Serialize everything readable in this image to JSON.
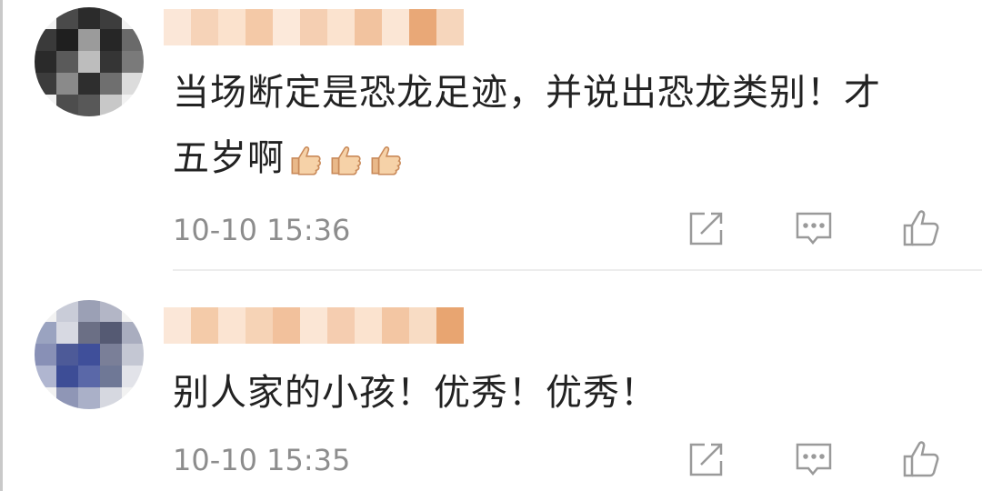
{
  "comments": [
    {
      "text": "当场断定是恐龙足迹，并说出恐龙类别！才五岁啊",
      "emoji": [
        "thumbs-up-icon",
        "thumbs-up-icon",
        "thumbs-up-icon"
      ],
      "time": "10-10 15:36",
      "actions": [
        "share-icon",
        "comment-icon",
        "like-icon"
      ]
    },
    {
      "text": "别人家的小孩！优秀！优秀！",
      "time": "10-10 15:35",
      "actions": [
        "share-icon",
        "comment-icon",
        "like-icon"
      ]
    }
  ],
  "colors": {
    "text": "#222222",
    "timestamp": "#8d8d8d",
    "icon": "#9a9a9a",
    "divider": "#ededed"
  }
}
